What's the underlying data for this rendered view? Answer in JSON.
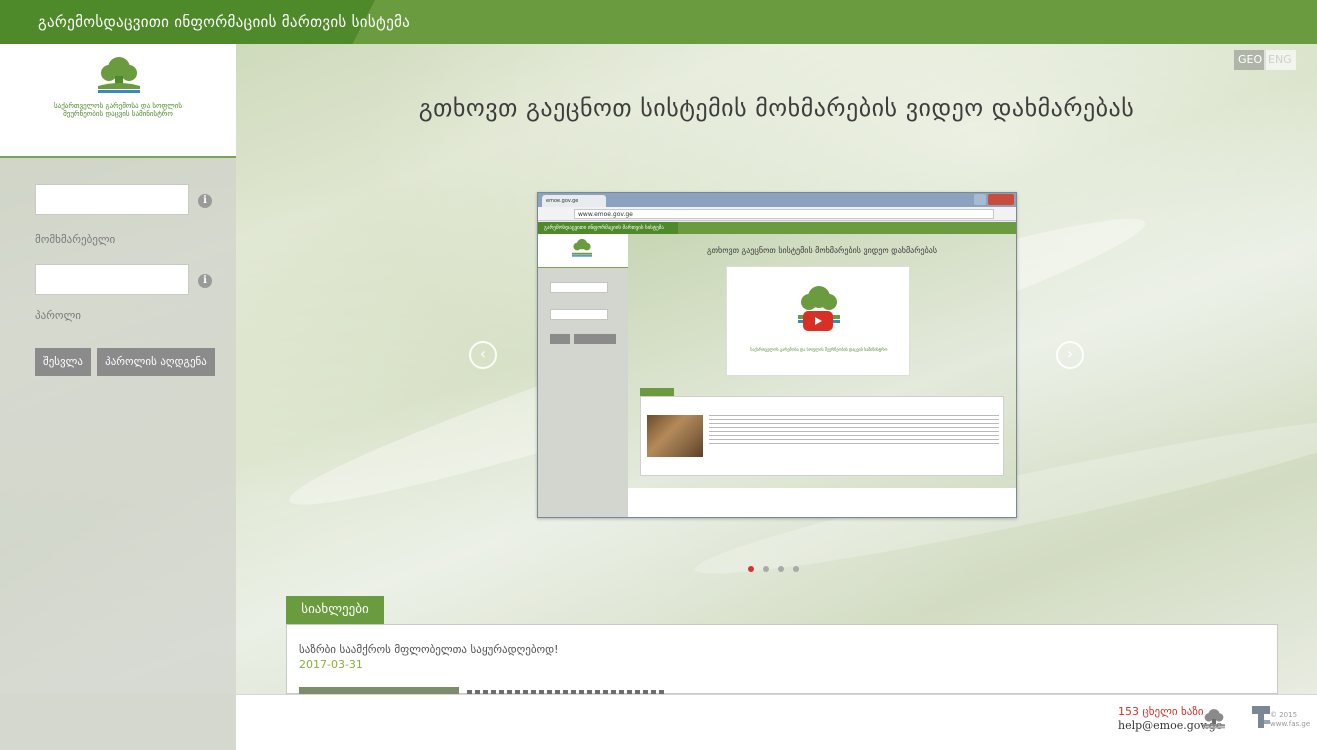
{
  "header": {
    "title": "გარემოსდაცვითი ინფორმაციის მართვის სისტემა"
  },
  "sidebar": {
    "logo_text": "საქართველოს გარემოსა და სოფლის მეურნეობის დაცვის სამინისტრო",
    "username": {
      "value": "",
      "label": "მომხმარებელი",
      "info_icon": "info-icon"
    },
    "password": {
      "value": "",
      "label": "პაროლი",
      "info_icon": "info-icon"
    },
    "login_label": "შესვლა",
    "reset_label": "პაროლის აღდგენა"
  },
  "lang": {
    "geo": "GEO",
    "eng": "ENG"
  },
  "main": {
    "headline": "გთხოვთ გაეცნოთ სისტემის მოხმარების ვიდეო დახმარებას",
    "prev_icon": "chevron-left-icon",
    "next_icon": "chevron-right-icon",
    "slide": {
      "tab_label": "emoe.gov.ge",
      "url": "www.emoe.gov.ge",
      "headline": "გთხოვთ გაეცნოთ სისტემის მოხმარების ვიდეო დახმარებას",
      "video_text": "საქართველოს გარემოსა და სოფლის მეურნეობის დაცვის სამინისტრო"
    },
    "dots_active": 1,
    "dots_count": 4
  },
  "news": {
    "tab_label": "სიახლეები",
    "title": "საზრბი საამქროს მფლობელთა საყურადღებოდ!",
    "date": "2017-03-31"
  },
  "footer": {
    "hotline": "153 ცხელი ხაზი",
    "email": "help@emoe.gov.ge",
    "copyright": "© 2015",
    "copyright_site": "www.fas.ge"
  },
  "colors": {
    "brand_green": "#6a9b3e",
    "dark_green": "#4f8a2a",
    "hotline_red": "#d9322a",
    "date_green": "#8cae3b"
  }
}
